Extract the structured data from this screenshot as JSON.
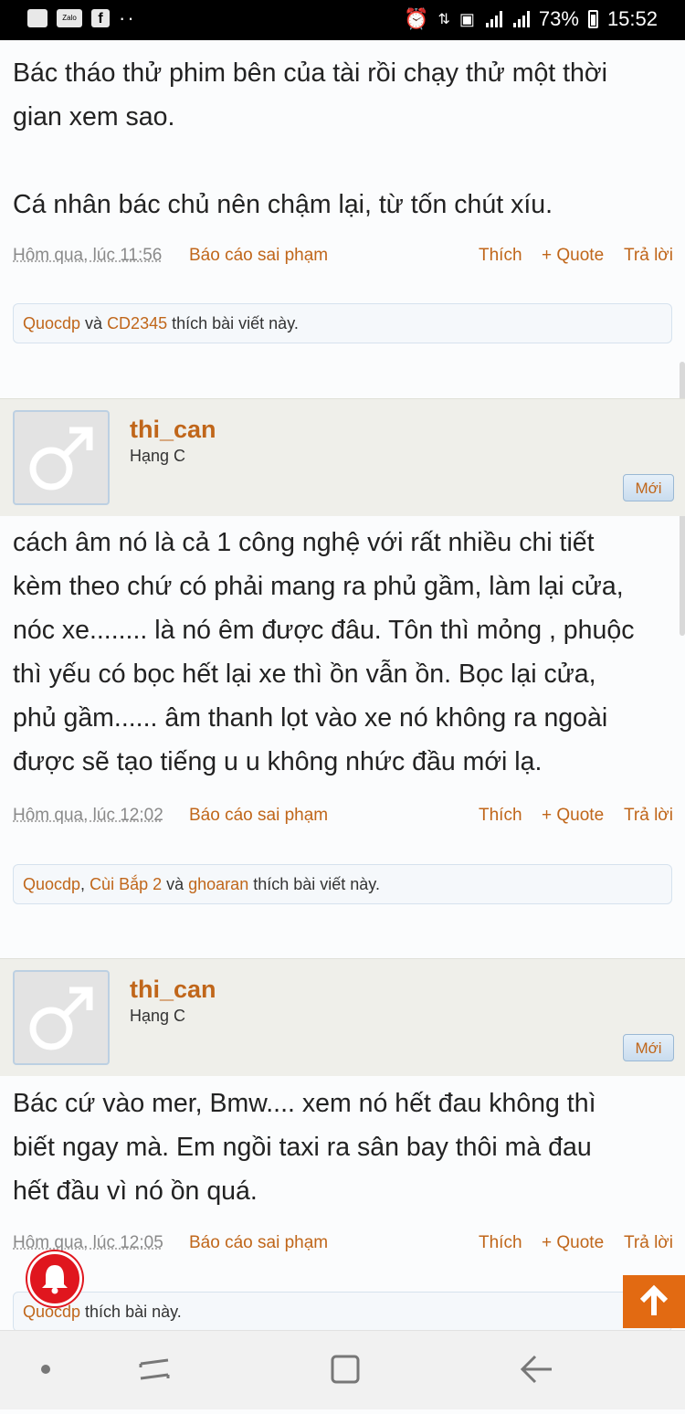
{
  "status": {
    "battery": "73%",
    "time": "15:52",
    "zalo": "Zalo",
    "fb": "f",
    "dots": "··"
  },
  "posts": [
    {
      "lines": [
        "Bác tháo thử phim bên của tài rồi chạy thử một thời",
        "gian xem sao.",
        "",
        "Cá nhân bác chủ nên chậm lại, từ tốn chút xíu."
      ],
      "date": "Hôm qua, lúc 11:56",
      "likes_users": [
        "Quocdp",
        "CD2345"
      ],
      "likes_seps": [
        " và "
      ],
      "likes_suffix": " thích bài viết này."
    },
    {
      "username": "thi_can",
      "rank": "Hạng C",
      "badge": "Mới",
      "lines": [
        "cách âm nó là cả 1 công nghệ với rất nhiều chi tiết",
        "kèm theo chứ có phải mang ra phủ gầm, làm lại cửa,",
        "nóc xe........ là nó êm được đâu. Tôn thì mỏng , phuộc",
        "thì yếu có bọc hết lại xe thì ồn vẫn ồn. Bọc lại cửa,",
        "phủ gầm...... âm thanh lọt vào xe nó không ra ngoài",
        "được sẽ tạo tiếng u u không nhức đầu mới lạ."
      ],
      "date": "Hôm qua, lúc 12:02",
      "likes_users": [
        "Quocdp",
        "Cùi Bắp 2",
        "ghoaran"
      ],
      "likes_seps": [
        ", ",
        " và "
      ],
      "likes_suffix": " thích bài viết này."
    },
    {
      "username": "thi_can",
      "rank": "Hạng C",
      "badge": "Mới",
      "lines": [
        "Bác cứ vào mer, Bmw.... xem nó hết đau không thì",
        "biết ngay mà. Em ngồi taxi ra sân bay thôi mà đau",
        "hết đầu vì nó ồn quá."
      ],
      "date": "Hôm qua, lúc 12:05",
      "likes_users": [
        "Quocdp"
      ],
      "likes_seps": [],
      "likes_suffix": " thích bài này."
    }
  ],
  "actions": {
    "report": "Báo cáo sai phạm",
    "like": "Thích",
    "quote": "+ Quote",
    "reply": "Trả lời"
  },
  "colors": {
    "accent": "#c0661a",
    "scroll_top": "#e26a12",
    "bell": "#e0161e"
  }
}
